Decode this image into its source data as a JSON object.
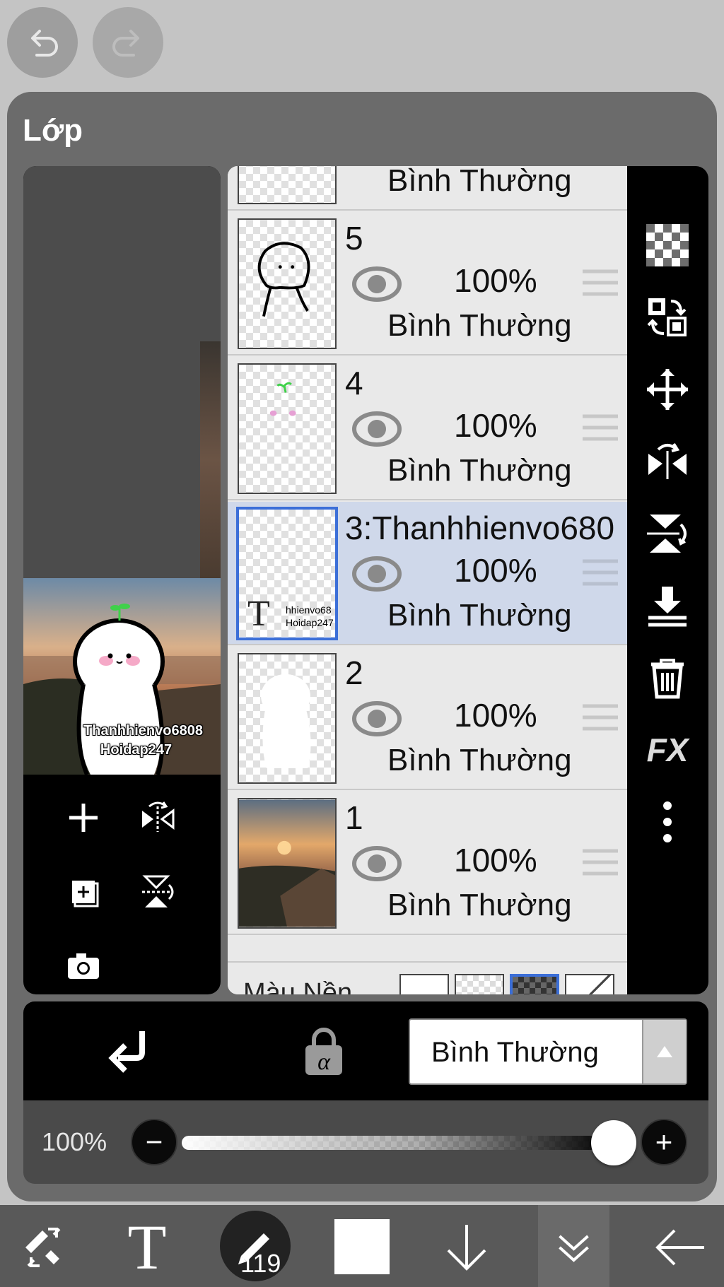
{
  "colors": {
    "panel_bg": "#6b6b6b",
    "selection_border": "#3c6fd8",
    "selected_row_bg": "#cfd8ea",
    "toolbar_bg": "#595959"
  },
  "panel": {
    "title": "Lớp"
  },
  "preview": {
    "watermark_line1": "Thanhhienvo6808",
    "watermark_line2": "Hoidap247"
  },
  "layers": [
    {
      "name": "",
      "opacity": "",
      "blend": "Bình Thường"
    },
    {
      "name": "5",
      "opacity": "100%",
      "blend": "Bình Thường"
    },
    {
      "name": "4",
      "opacity": "100%",
      "blend": "Bình Thường"
    },
    {
      "name": "3:Thanhhienvo680",
      "opacity": "100%",
      "blend": "Bình Thường",
      "selected": true,
      "thumb_text_line1": "hhienvo68",
      "thumb_text_line2": "Hoidap247",
      "thumb_glyph": "T"
    },
    {
      "name": "2",
      "opacity": "100%",
      "blend": "Bình Thường"
    },
    {
      "name": "1",
      "opacity": "100%",
      "blend": "Bình Thường"
    }
  ],
  "background_row": {
    "label": "Màu Nền"
  },
  "right_tools": {
    "fx_label": "FX"
  },
  "mode_bar": {
    "blend_mode": "Bình Thường"
  },
  "opacity_bar": {
    "value": "100%",
    "minus": "−",
    "plus": "+",
    "level": 1.0
  },
  "bottom_bar": {
    "brush_size": "119"
  },
  "icons": [
    "undo-icon",
    "redo-icon",
    "add-layer-icon",
    "flip-horizontal-icon",
    "duplicate-layer-icon",
    "flip-vertical-icon",
    "camera-icon",
    "checker-icon",
    "reorder-icon",
    "move-icon",
    "merge-down-icon",
    "trash-icon",
    "more-icon",
    "eye-icon",
    "drag-handle-icon",
    "alpha-lock-icon",
    "clip-icon",
    "transform-icon",
    "text-tool-icon",
    "brush-icon",
    "arrow-down-icon",
    "chevron-double-down-icon",
    "back-arrow-icon"
  ]
}
